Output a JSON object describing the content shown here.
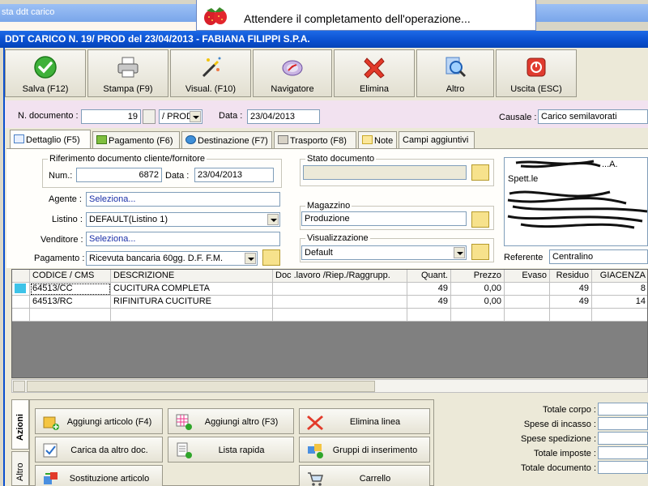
{
  "background_window": {
    "title": "sta ddt carico"
  },
  "wait_popup": {
    "message": "Attendere il completamento dell'operazione..."
  },
  "window": {
    "title": "DDT CARICO N. 19/ PROD del 23/04/2013 - FABIANA FILIPPI S.P.A."
  },
  "toolbar": [
    {
      "label": "Salva (F12)",
      "icon": "check-icon"
    },
    {
      "label": "Stampa (F9)",
      "icon": "printer-icon"
    },
    {
      "label": "Visual. (F10)",
      "icon": "magic-wand-icon"
    },
    {
      "label": "Navigatore",
      "icon": "compass-icon"
    },
    {
      "label": "Elimina",
      "icon": "delete-x-icon"
    },
    {
      "label": "Altro",
      "icon": "search-icon"
    },
    {
      "label": "Uscita (ESC)",
      "icon": "power-icon"
    }
  ],
  "header": {
    "doc_number_label": "N. documento :",
    "doc_number": "19",
    "series": "/ PROD",
    "date_label": "Data :",
    "date": "23/04/2013",
    "reason_label": "Causale :",
    "reason": "Carico semilavorati"
  },
  "tabs": [
    {
      "label": "Dettaglio (F5)",
      "active": true
    },
    {
      "label": "Pagamento (F6)",
      "active": false
    },
    {
      "label": "Destinazione (F7)",
      "active": false
    },
    {
      "label": "Trasporto (F8)",
      "active": false
    },
    {
      "label": "Note",
      "active": false
    },
    {
      "label": "Campi aggiuntivi",
      "active": false
    }
  ],
  "detail": {
    "ref_group_title": "Riferimento documento cliente/fornitore",
    "ref_num_label": "Num.:",
    "ref_num": "6872",
    "ref_date_label": "Data :",
    "ref_date": "23/04/2013",
    "agent_label": "Agente :",
    "agent_value": "Seleziona...",
    "list_label": "Listino :",
    "list_value": "DEFAULT(Listino 1)",
    "seller_label": "Venditore :",
    "seller_value": "Seleziona...",
    "payment_label": "Pagamento :",
    "payment_value": "Ricevuta bancaria 60gg. D.F. F.M.",
    "status_group_title": "Stato documento",
    "status_value": "",
    "warehouse_group_title": "Magazzino",
    "warehouse_value": "Produzione",
    "view_group_title": "Visualizzazione",
    "view_value": "Default",
    "address_fragment": "...A.",
    "address_salutation": "Spett.le",
    "referent_label": "Referente",
    "referent_value": "Centralino"
  },
  "grid": {
    "columns": [
      "CODICE / CMS",
      "DESCRIZIONE",
      "Doc .lavoro /Riep./Raggrupp.",
      "Quant.",
      "Prezzo",
      "Evaso",
      "Residuo",
      "GIACENZA"
    ],
    "rows": [
      {
        "code": "64513/CC",
        "description": "CUCITURA COMPLETA",
        "doc": "",
        "qty": "49",
        "price": "0,00",
        "evaded": "",
        "residual": "49",
        "stock": "8"
      },
      {
        "code": "64513/RC",
        "description": "RIFINITURA CUCITURE",
        "doc": "",
        "qty": "49",
        "price": "0,00",
        "evaded": "",
        "residual": "49",
        "stock": "14"
      }
    ]
  },
  "side_tabs": {
    "actions": "Azioni",
    "other": "Altro"
  },
  "actions": [
    {
      "label": "Aggiungi articolo (F4)",
      "icon": "add-box-icon"
    },
    {
      "label": "Aggiungi altro (F3)",
      "icon": "add-grid-icon"
    },
    {
      "label": "Elimina linea",
      "icon": "delete-x-icon"
    },
    {
      "label": "Carica da altro doc.",
      "icon": "load-doc-icon"
    },
    {
      "label": "Lista rapida",
      "icon": "quick-list-icon"
    },
    {
      "label": "Gruppi di inserimento",
      "icon": "group-insert-icon"
    },
    {
      "label": "Sostituzione articolo",
      "icon": "replace-icon"
    },
    {
      "label": "",
      "icon": "empty"
    },
    {
      "label": "Carrello",
      "icon": "cart-icon"
    }
  ],
  "totals": [
    {
      "label": "Totale corpo :"
    },
    {
      "label": "Spese di incasso :"
    },
    {
      "label": "Spese spedizione :"
    },
    {
      "label": "Totale imposte :"
    },
    {
      "label": "Totale documento :"
    }
  ]
}
